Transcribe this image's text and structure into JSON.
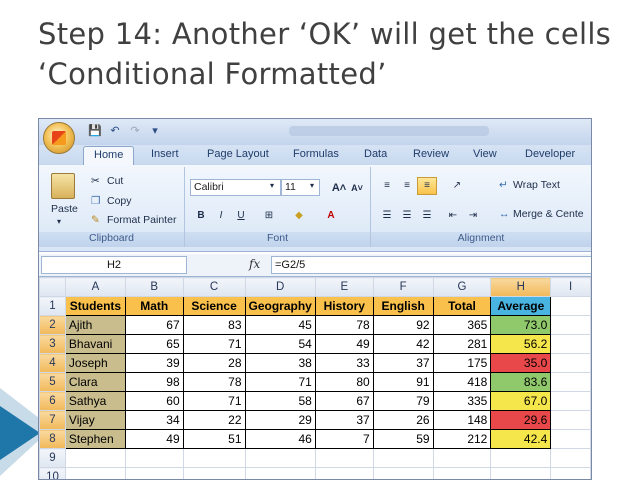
{
  "slide": {
    "title": "Step 14: Another ‘OK’ will get the cells ‘Conditional Formatted’"
  },
  "ribbon": {
    "tabs": [
      "Home",
      "Insert",
      "Page Layout",
      "Formulas",
      "Data",
      "Review",
      "View",
      "Developer"
    ],
    "active_tab": "Home",
    "clipboard": {
      "paste": "Paste",
      "cut": "Cut",
      "copy": "Copy",
      "format_painter": "Format Painter",
      "label": "Clipboard"
    },
    "font": {
      "name": "Calibri",
      "size": "11",
      "grow": "A˄",
      "shrink": "A˅",
      "bold": "B",
      "italic": "I",
      "underline": "U",
      "label": "Font"
    },
    "alignment": {
      "wrap_text": "Wrap Text",
      "merge_center": "Merge & Cente",
      "label": "Alignment"
    }
  },
  "formula_bar": {
    "name_box": "H2",
    "fx": "fx",
    "formula": "=G2/5"
  },
  "grid": {
    "col_headers": [
      "A",
      "B",
      "C",
      "D",
      "E",
      "F",
      "G",
      "H",
      "I"
    ],
    "header_row": [
      "Students",
      "Math",
      "Science",
      "Geography",
      "History",
      "English",
      "Total",
      "Average"
    ],
    "rows": [
      {
        "n": "2",
        "name": "Ajith",
        "vals": [
          "67",
          "83",
          "45",
          "78",
          "92",
          "365"
        ],
        "avg": "73.0"
      },
      {
        "n": "3",
        "name": "Bhavani",
        "vals": [
          "65",
          "71",
          "54",
          "49",
          "42",
          "281"
        ],
        "avg": "56.2"
      },
      {
        "n": "4",
        "name": "Joseph",
        "vals": [
          "39",
          "28",
          "38",
          "33",
          "37",
          "175"
        ],
        "avg": "35.0"
      },
      {
        "n": "5",
        "name": "Clara",
        "vals": [
          "98",
          "78",
          "71",
          "80",
          "91",
          "418"
        ],
        "avg": "83.6"
      },
      {
        "n": "6",
        "name": "Sathya",
        "vals": [
          "60",
          "71",
          "58",
          "67",
          "79",
          "335"
        ],
        "avg": "67.0"
      },
      {
        "n": "7",
        "name": "Vijay",
        "vals": [
          "34",
          "22",
          "29",
          "37",
          "26",
          "148"
        ],
        "avg": "29.6"
      },
      {
        "n": "8",
        "name": "Stephen",
        "vals": [
          "49",
          "51",
          "46",
          "7",
          "59",
          "212"
        ],
        "avg": "42.4"
      }
    ],
    "row_numbers": [
      "1",
      "2",
      "3",
      "4",
      "5",
      "6",
      "7",
      "8",
      "9",
      "10"
    ],
    "cond_colors": {
      "green": "#8fc96b",
      "yellow": "#f4e64b",
      "red": "#e8484a"
    },
    "avg_fill": [
      "green",
      "yellow",
      "red",
      "green",
      "yellow",
      "red",
      "yellow"
    ]
  }
}
